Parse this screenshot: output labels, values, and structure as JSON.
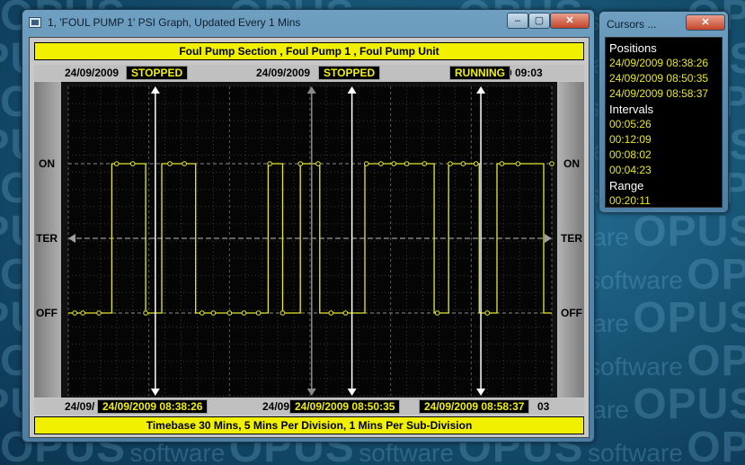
{
  "desktop": {
    "wallpaper_words": [
      "OPUS",
      "software"
    ]
  },
  "main_window": {
    "title": "1, 'FOUL PUMP 1' PSI Graph, Updated Every 1 Mins",
    "minimize": "–",
    "maximize": "▢",
    "close": "✕",
    "header": "Foul Pump Section , Foul Pump 1 , Foul Pump Unit",
    "top_strip": {
      "left_date": "24/09/2009",
      "mid_date": "24/09/2009",
      "right_partial": "9  09:03",
      "badges": [
        "STOPPED",
        "STOPPED",
        "RUNNING"
      ]
    },
    "bottom_strip": {
      "left_partial": "24/09/",
      "mid_partial": "24/09/",
      "right_partial": "03",
      "cursor_labels": [
        "24/09/2009  08:38:26",
        "24/09/2009  08:50:35",
        "24/09/2009  08:58:37"
      ]
    },
    "footer": "Timebase 30 Mins,  5 Mins Per Division,  1 Mins Per Sub-Division"
  },
  "cursor_window": {
    "title": "Cursors ...",
    "close": "✕",
    "positions_label": "Positions",
    "positions": [
      "24/09/2009  08:38:26",
      "24/09/2009  08:50:35",
      "24/09/2009  08:58:37"
    ],
    "intervals_label": "Intervals",
    "intervals": [
      "00:05:26",
      "00:12:09",
      "00:08:02",
      "00:04:23"
    ],
    "range_label": "Range",
    "range": "00:20:11"
  },
  "chart_data": {
    "type": "line",
    "step": true,
    "x_range_minutes": [
      0,
      30
    ],
    "levels": [
      "OFF",
      "TER",
      "ON"
    ],
    "y_left_labels": [
      "ON",
      "TER",
      "OFF"
    ],
    "y_right_labels": [
      "ON",
      "TER",
      "OFF"
    ],
    "y_values": {
      "OFF": 0,
      "TER": 1,
      "ON": 2
    },
    "grid": true,
    "series": [
      {
        "color": "#e8e832",
        "points": [
          [
            0.0,
            0
          ],
          [
            2.7,
            0
          ],
          [
            2.7,
            2
          ],
          [
            4.8,
            2
          ],
          [
            4.8,
            0
          ],
          [
            5.8,
            0
          ],
          [
            5.8,
            2
          ],
          [
            7.9,
            2
          ],
          [
            7.9,
            0
          ],
          [
            12.4,
            0
          ],
          [
            12.4,
            2
          ],
          [
            13.3,
            2
          ],
          [
            13.3,
            0
          ],
          [
            14.4,
            0
          ],
          [
            14.4,
            2
          ],
          [
            15.6,
            2
          ],
          [
            15.6,
            0
          ],
          [
            18.4,
            0
          ],
          [
            18.4,
            2
          ],
          [
            22.7,
            2
          ],
          [
            22.7,
            0
          ],
          [
            23.6,
            0
          ],
          [
            23.6,
            2
          ],
          [
            25.5,
            2
          ],
          [
            25.5,
            0
          ],
          [
            26.6,
            0
          ],
          [
            26.6,
            2
          ],
          [
            29.5,
            2
          ],
          [
            29.5,
            0
          ],
          [
            30.0,
            0
          ]
        ],
        "markers": [
          [
            0.4,
            0
          ],
          [
            0.9,
            0
          ],
          [
            1.9,
            0
          ],
          [
            3.0,
            2
          ],
          [
            4.0,
            2
          ],
          [
            4.8,
            0
          ],
          [
            6.3,
            2
          ],
          [
            7.2,
            2
          ],
          [
            8.3,
            0
          ],
          [
            9.0,
            0
          ],
          [
            10.0,
            0
          ],
          [
            10.9,
            0
          ],
          [
            11.8,
            0
          ],
          [
            12.5,
            2
          ],
          [
            13.3,
            0
          ],
          [
            14.4,
            2
          ],
          [
            15.5,
            2
          ],
          [
            16.3,
            0
          ],
          [
            17.2,
            0
          ],
          [
            18.5,
            2
          ],
          [
            19.4,
            2
          ],
          [
            20.2,
            2
          ],
          [
            21.0,
            2
          ],
          [
            22.1,
            2
          ],
          [
            22.9,
            0
          ],
          [
            23.7,
            2
          ],
          [
            24.5,
            2
          ],
          [
            25.3,
            2
          ],
          [
            26.0,
            0
          ],
          [
            26.9,
            2
          ],
          [
            27.9,
            2
          ],
          [
            30.0,
            2
          ]
        ]
      }
    ],
    "cursors": [
      {
        "x": 5.4,
        "label": "24/09/2009  08:38:26",
        "state": "STOPPED",
        "color": "#ffffff"
      },
      {
        "x": 15.1,
        "label": "",
        "state": "",
        "color": "#8a8a8a"
      },
      {
        "x": 17.6,
        "label": "24/09/2009  08:50:35",
        "state": "STOPPED",
        "color": "#ffffff"
      },
      {
        "x": 25.6,
        "label": "24/09/2009  08:58:37",
        "state": "RUNNING",
        "color": "#ffffff"
      }
    ]
  }
}
